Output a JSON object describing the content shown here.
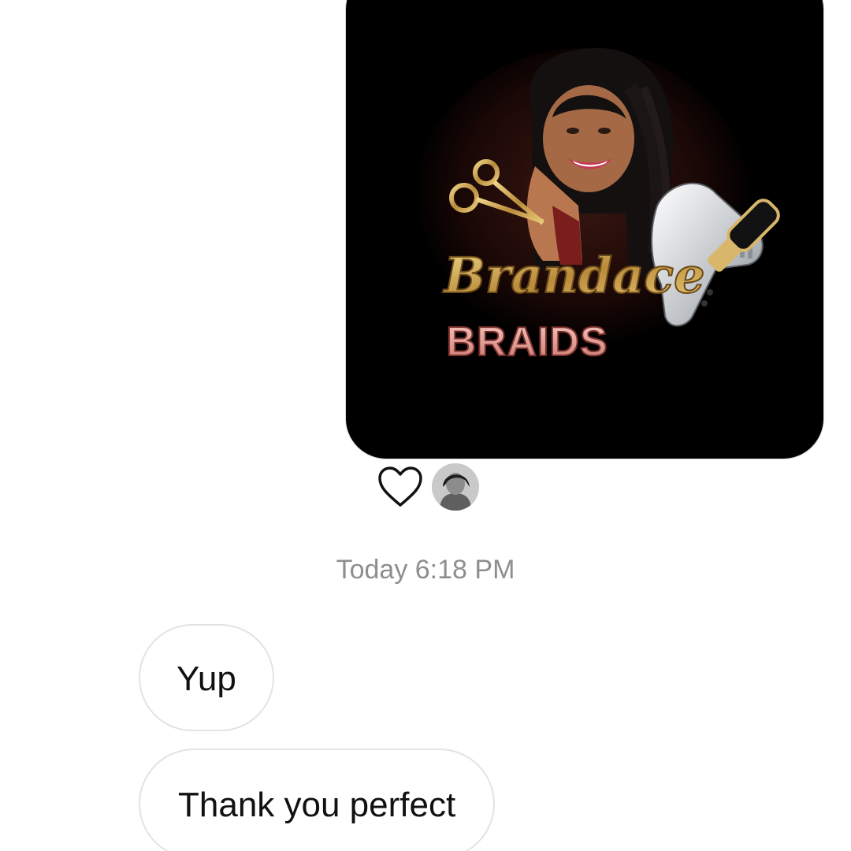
{
  "conversation": {
    "image_message": {
      "logo_text_primary": "Brandace",
      "logo_text_secondary": "BRAIDS",
      "colors": {
        "background": "#000000",
        "gold": "#c9a24a",
        "pink": "#e7a8a0"
      }
    },
    "reactions": {
      "heart_icon": "heart-outline-icon"
    },
    "timestamp": "Today 6:18 PM",
    "messages": [
      {
        "text": "Yup"
      },
      {
        "text": "Thank you perfect"
      }
    ]
  }
}
